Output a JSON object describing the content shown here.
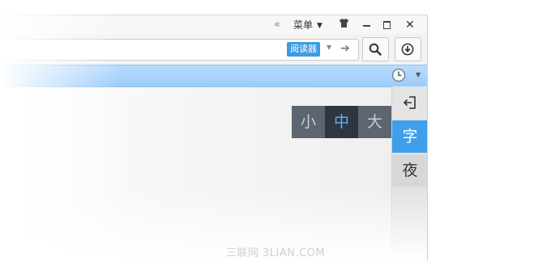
{
  "titlebar": {
    "collapse_glyph": "«",
    "menu_label": "菜单",
    "menu_caret": "▼",
    "skin_icon": "shirt-icon",
    "close_glyph": "✕"
  },
  "toolbar": {
    "reader_label": "阅读器",
    "addr_caret": "▼",
    "addr_go": "➔",
    "search_icon": "search-icon",
    "download_icon": "download-icon"
  },
  "bookmarkbar": {
    "history_icon": "clock-icon",
    "caret": "▼"
  },
  "sidepanel": {
    "exit_icon": "exit-icon",
    "font_label": "字",
    "night_label": "夜"
  },
  "fontsize": {
    "small": "小",
    "medium": "中",
    "large": "大",
    "selected": "中"
  },
  "colors": {
    "accent": "#3f9fea",
    "popup_bg": "#5d6670",
    "popup_selected_bg": "#2e3740",
    "bookmark_bar": "#a9d3fb"
  },
  "watermark": "三联网 3LIAN.COM"
}
